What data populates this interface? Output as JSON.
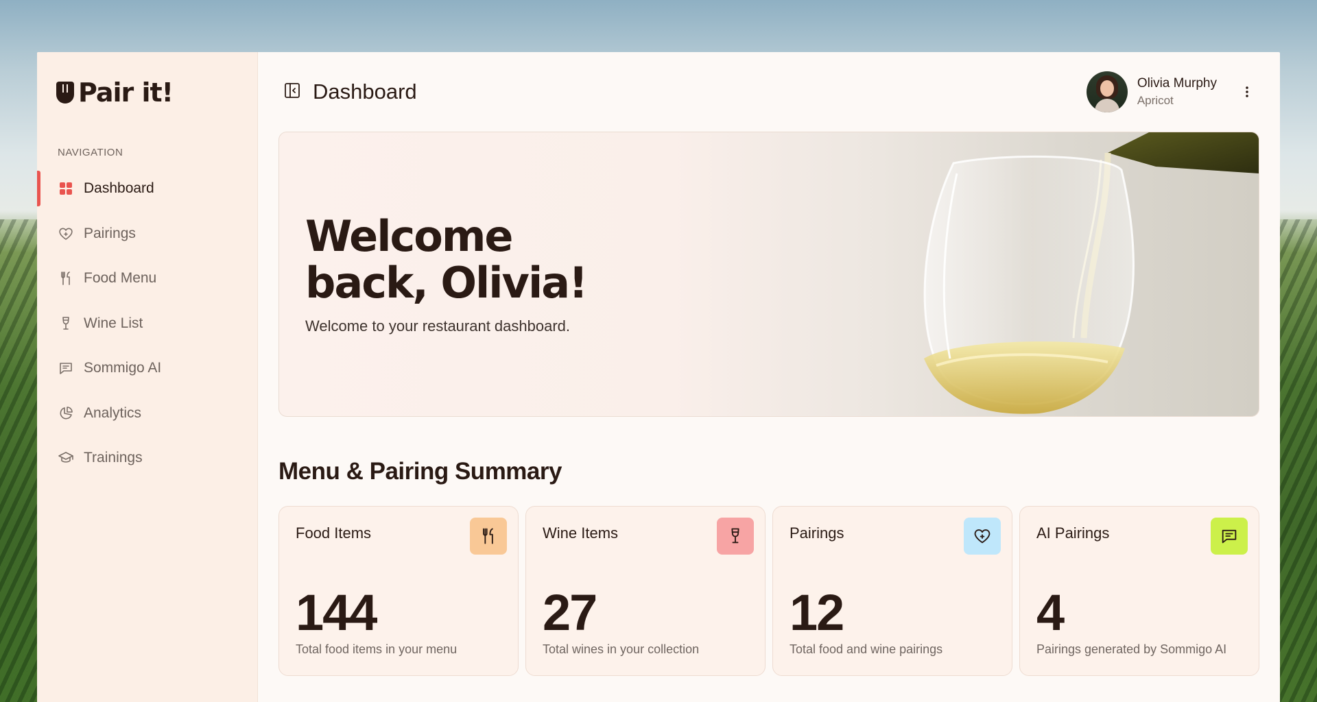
{
  "app": {
    "logo_text": "Pair it!",
    "logo_icon": "fork-shield-icon"
  },
  "sidebar": {
    "heading": "NAVIGATION",
    "items": [
      {
        "label": "Dashboard",
        "icon": "grid-icon",
        "active": true
      },
      {
        "label": "Pairings",
        "icon": "heart-plus-icon",
        "active": false
      },
      {
        "label": "Food Menu",
        "icon": "fork-knife-icon",
        "active": false
      },
      {
        "label": "Wine List",
        "icon": "wine-glass-icon",
        "active": false
      },
      {
        "label": "Sommigo AI",
        "icon": "chat-icon",
        "active": false
      },
      {
        "label": "Analytics",
        "icon": "pie-chart-icon",
        "active": false
      },
      {
        "label": "Trainings",
        "icon": "graduation-cap-icon",
        "active": false
      }
    ]
  },
  "header": {
    "title": "Dashboard",
    "toggle_icon": "sidebar-toggle-icon",
    "user": {
      "name": "Olivia Murphy",
      "org": "Apricot",
      "menu_icon": "more-vertical-icon"
    }
  },
  "hero": {
    "title": "Welcome\nback, Olivia!",
    "subtitle": "Welcome to your restaurant dashboard."
  },
  "summary": {
    "title": "Menu & Pairing Summary",
    "cards": [
      {
        "label": "Food Items",
        "value": "144",
        "desc": "Total food items in your menu",
        "icon": "fork-knife-icon",
        "color": "#f9c896"
      },
      {
        "label": "Wine Items",
        "value": "27",
        "desc": "Total wines in your collection",
        "icon": "wine-glass-icon",
        "color": "#f7a4a4"
      },
      {
        "label": "Pairings",
        "value": "12",
        "desc": "Total food and wine pairings",
        "icon": "heart-plus-icon",
        "color": "#bfe7fb"
      },
      {
        "label": "AI Pairings",
        "value": "4",
        "desc": "Pairings generated by Sommigo AI",
        "icon": "chat-icon",
        "color": "#ccf04a"
      }
    ]
  },
  "colors": {
    "accent": "#e9544f",
    "sidebar_bg": "#fcefe6",
    "text_dark": "#2a1a14"
  }
}
